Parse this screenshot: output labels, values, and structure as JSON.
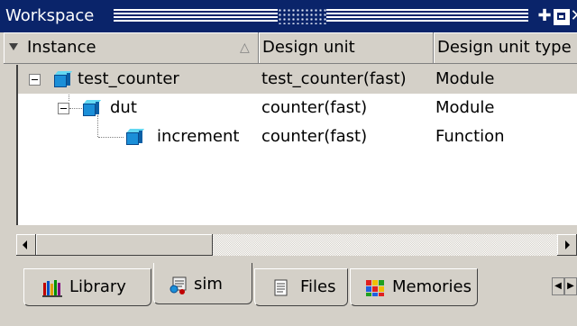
{
  "window": {
    "title": "Workspace"
  },
  "columns": {
    "instance": "Instance",
    "design_unit": "Design unit",
    "design_unit_type": "Design unit type"
  },
  "rows": [
    {
      "instance": "test_counter",
      "design_unit": "test_counter(fast)",
      "design_unit_type": "Module",
      "depth": 0,
      "expanded": true,
      "selected": true
    },
    {
      "instance": "dut",
      "design_unit": "counter(fast)",
      "design_unit_type": "Module",
      "depth": 1,
      "expanded": true,
      "selected": false
    },
    {
      "instance": "increment",
      "design_unit": "counter(fast)",
      "design_unit_type": "Function",
      "depth": 2,
      "expanded": false,
      "selected": false
    }
  ],
  "tabs": [
    {
      "label": "Library",
      "icon": "library-icon",
      "active": false
    },
    {
      "label": "sim",
      "icon": "sim-icon",
      "active": true
    },
    {
      "label": "Files",
      "icon": "files-icon",
      "active": false
    },
    {
      "label": "Memories",
      "icon": "memories-icon",
      "active": false
    }
  ],
  "colors": {
    "titlebar": "#0a246a",
    "selection": "#d4d0c8",
    "background": "#ffffff",
    "chrome": "#d4d0c8"
  }
}
